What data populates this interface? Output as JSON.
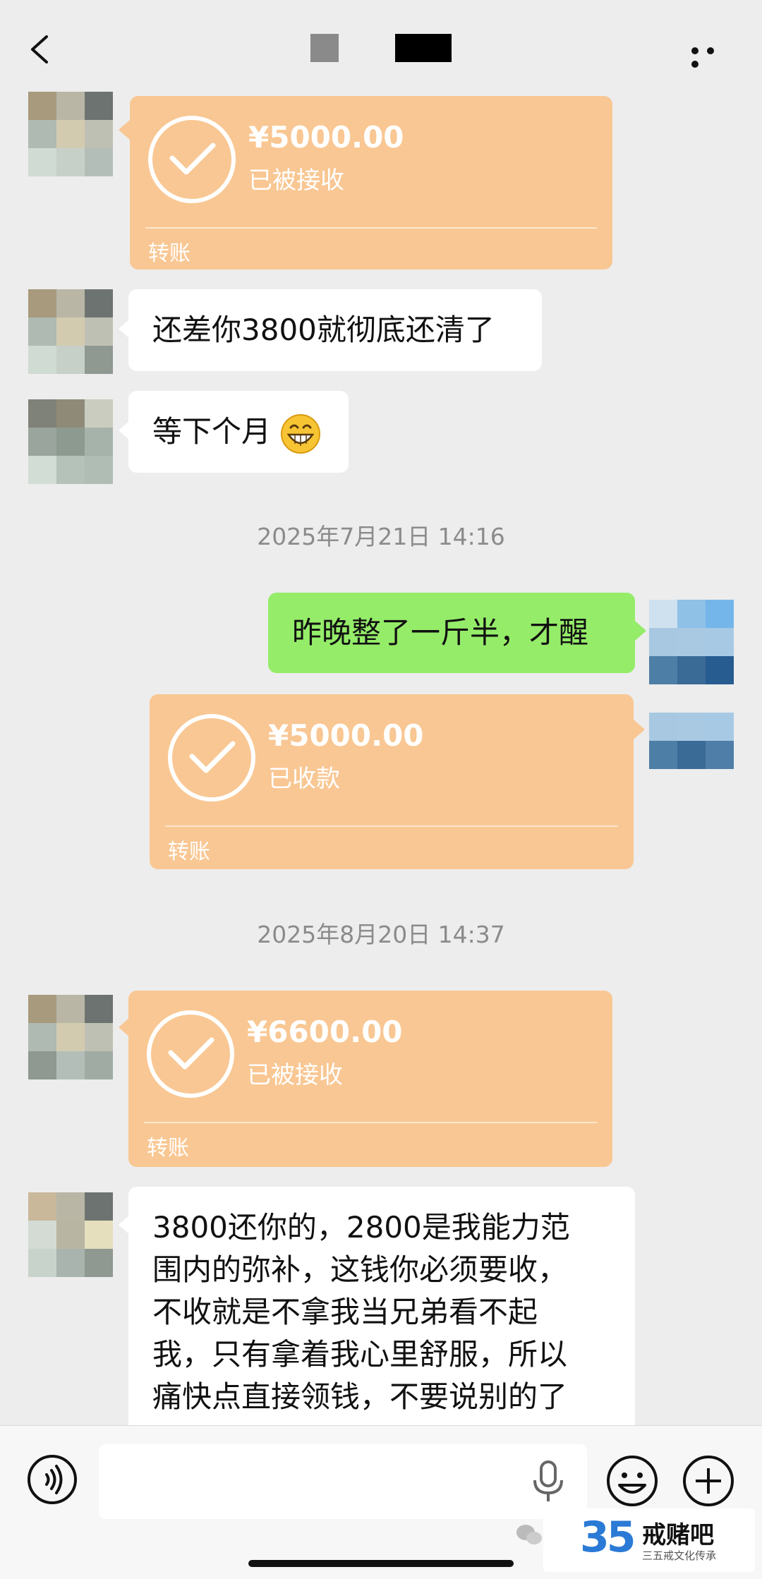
{
  "header": {
    "back_icon": "chevron-left-icon",
    "more_icon": "more-dots-icon"
  },
  "messages": [
    {
      "side": "left",
      "type": "transfer",
      "amount": "¥5000.00",
      "status": "已被接收",
      "label": "转账"
    },
    {
      "side": "left",
      "type": "text",
      "text": "还差你3800就彻底还清了"
    },
    {
      "side": "left",
      "type": "text",
      "text": "等下个月",
      "emoji": "grinning-face"
    },
    {
      "type": "timestamp",
      "text": "2025年7月21日 14:16"
    },
    {
      "side": "right",
      "type": "text",
      "text": "昨晚整了一斤半，才醒"
    },
    {
      "side": "right",
      "type": "transfer",
      "amount": "¥5000.00",
      "status": "已收款",
      "label": "转账"
    },
    {
      "type": "timestamp",
      "text": "2025年8月20日 14:37"
    },
    {
      "side": "left",
      "type": "transfer",
      "amount": "¥6600.00",
      "status": "已被接收",
      "label": "转账"
    },
    {
      "side": "left",
      "type": "text",
      "lines": [
        "3800还你的，2800是我能力范",
        "围内的弥补，这钱你必须要收，",
        "不收就是不拿我当兄弟看不起",
        "我，只有拿着我心里舒服，所以",
        "痛快点直接领钱，不要说别的了"
      ]
    }
  ],
  "bottom_bar": {
    "voice_icon": "voice-mode-icon",
    "mic_icon": "microphone-icon",
    "emoji_icon": "smiley-icon",
    "plus_icon": "plus-circle-icon"
  },
  "watermark": {
    "number": "35",
    "name": "戒赌吧",
    "subtitle": "三五戒文化传承"
  },
  "colors": {
    "background": "#ededed",
    "transfer_card": "#f9c793",
    "sent_bubble": "#95ec69",
    "received_bubble": "#ffffff"
  }
}
